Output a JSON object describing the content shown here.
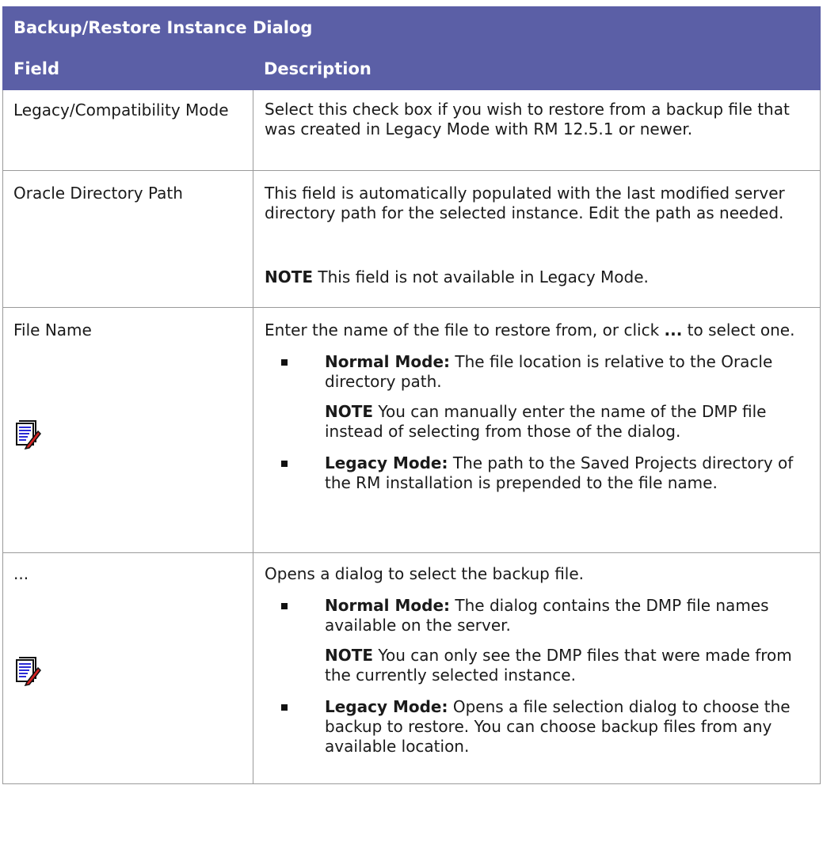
{
  "table": {
    "title": "Backup/Restore Instance Dialog",
    "headers": [
      "Field",
      "Description"
    ],
    "rows": {
      "legacy": {
        "field": "Legacy/Compatibility Mode",
        "desc": "Select this check box if you wish to restore from a backup file that was created in Legacy Mode with RM 12.5.1 or newer."
      },
      "oracle": {
        "field": "Oracle Directory Path",
        "desc": "This field is automatically populated with the last modified server directory path for the selected instance. Edit the path as needed.",
        "note_label": "NOTE",
        "note_text": " This field is not available in Legacy Mode."
      },
      "filename": {
        "field": "File Name",
        "desc_pre": "Enter the name of the file to restore from, or click ",
        "desc_bold": "...",
        "desc_post": " to select one.",
        "icon": "note-icon",
        "b1_label": "Normal Mode:",
        "b1_text": " The file location is relative to the Oracle directory path.",
        "note_label": "NOTE",
        "note_text": " You can manually enter the name of the DMP file instead of selecting from those of the dialog.",
        "b2_label": "Legacy Mode:",
        "b2_text": " The path to the Saved Projects directory of the RM installation is prepended to the file name."
      },
      "ellipsis": {
        "field": "...",
        "desc": "Opens a dialog to select the backup file.",
        "icon": "note-icon",
        "b1_label": "Normal Mode:",
        "b1_text": " The dialog contains the DMP file names available on the server.",
        "note_label": "NOTE",
        "note_text": " You can only see the DMP files that were made from the currently selected instance.",
        "b2_label": "Legacy Mode:",
        "b2_text": " Opens a file selection dialog to choose the backup to restore. You can choose backup files from any available location."
      }
    }
  },
  "colors": {
    "header_bg": "#5b5fa6",
    "header_text": "#ffffff",
    "border": "#9a9a9a"
  }
}
